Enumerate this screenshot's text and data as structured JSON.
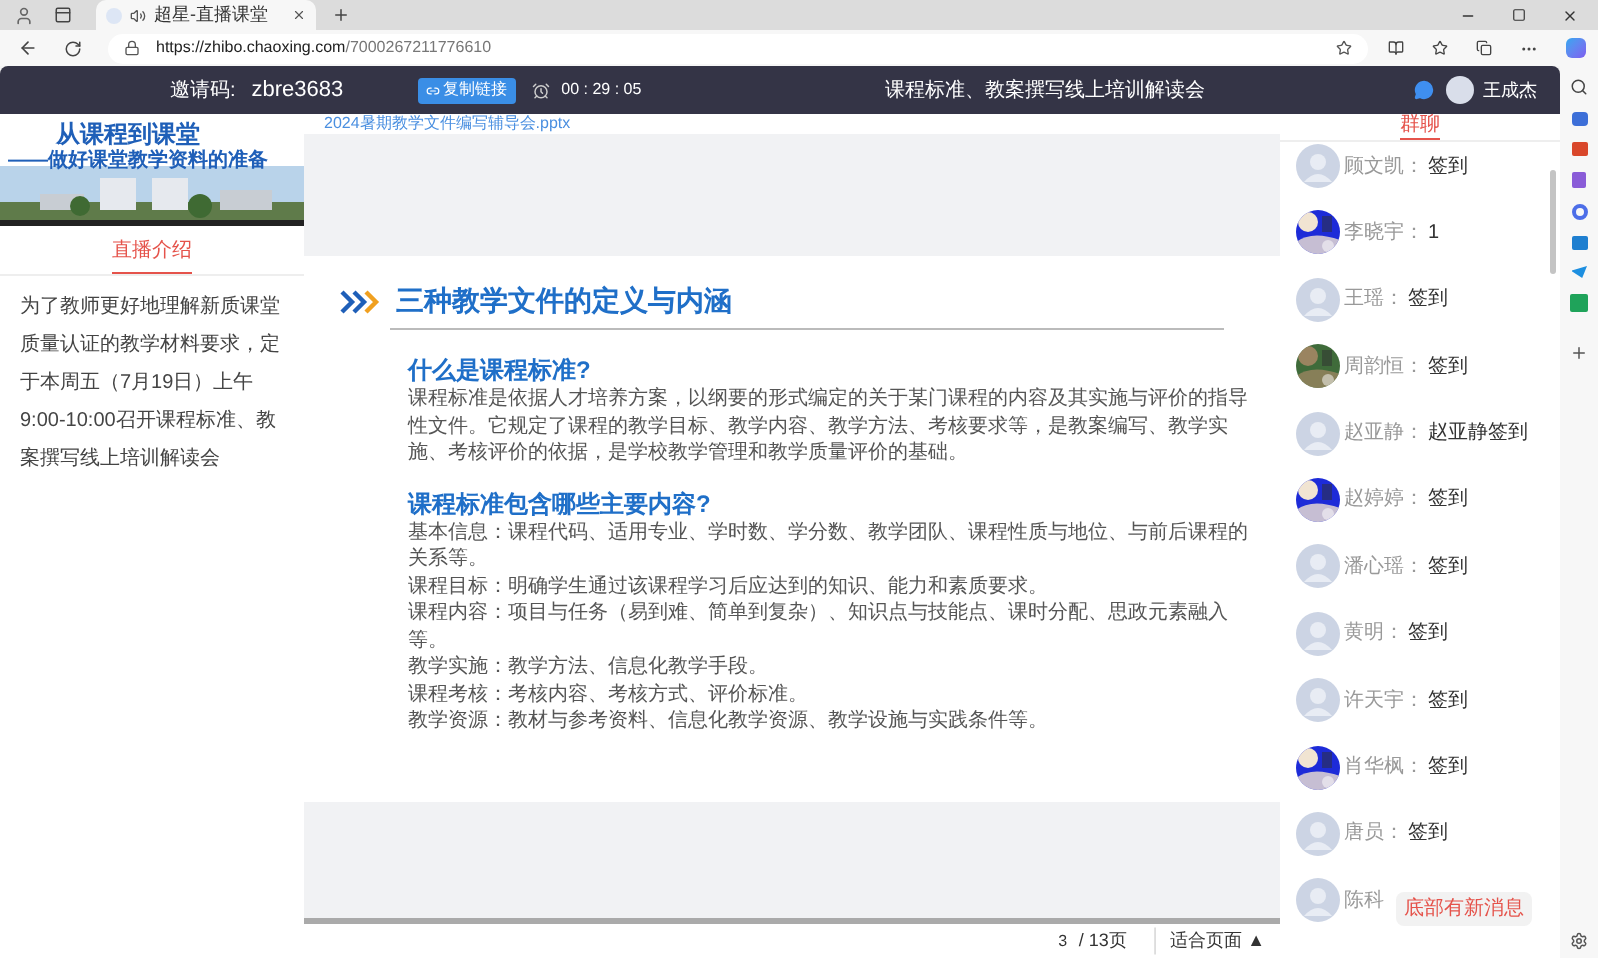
{
  "browser": {
    "tab_title": "超星-直播课堂",
    "url_host": "https://zhibo.chaoxing.com",
    "url_path": "/7000267211776610"
  },
  "header": {
    "invite_label": "邀请码:",
    "invite_code": "zbre3683",
    "copy_button": "复制链接",
    "timer": "00 : 29 : 05",
    "title": "课程标准、教案撰写线上培训解读会",
    "user": "王成杰"
  },
  "left": {
    "cover_title": "从课程到课堂",
    "cover_subtitle": "——做好课堂教学资料的准备",
    "tabs": [
      {
        "label": "直播介绍",
        "selected": true
      }
    ],
    "description": "为了教师更好地理解新质课堂质量认证的教学材料要求，定于本周五（7月19日）上午9:00-10:00召开课程标准、教案撰写线上培训解读会"
  },
  "document": {
    "filename": "2024暑期教学文件编写辅导会.pptx",
    "slide": {
      "heading": "三种教学文件的定义与内涵",
      "sections": [
        {
          "title": "什么是课程标准?",
          "lines": [
            "课程标准是依据人才培养方案，以纲要的形式编定的关于某门课程的内容及其实施与评价的指导性文件。它规定了课程的教学目标、教学内容、教学方法、考核要求等，是教案编写、教学实施、考核评价的依据，是学校教学管理和教学质量评价的基础。"
          ]
        },
        {
          "title": "课程标准包含哪些主要内容?",
          "lines": [
            "基本信息：课程代码、适用专业、学时数、学分数、教学团队、课程性质与地位、与前后课程的关系等。",
            "课程目标：明确学生通过该课程学习后应达到的知识、能力和素质要求。",
            "课程内容：项目与任务（易到难、简单到复杂）、知识点与技能点、课时分配、思政元素融入等。",
            "教学实施：教学方法、信息化教学手段。",
            "课程考核：考核内容、考核方式、评价标准。",
            "教学资源：教材与参考资料、信息化教学资源、教学设施与实践条件等。"
          ]
        }
      ]
    },
    "page": "3",
    "pages": "/ 13页",
    "fit": "适合页面 ▲"
  },
  "chat": {
    "tabs": [
      {
        "label": "群聊",
        "selected": true
      }
    ],
    "messages": [
      {
        "name": "顾文凯：",
        "text": "签到",
        "kind": "default"
      },
      {
        "name": "李晓宇：",
        "text": "1"
      },
      {
        "name": "王瑶：",
        "text": "签到",
        "kind": "default"
      },
      {
        "name": "周韵恒：",
        "text": "签到"
      },
      {
        "name": "赵亚静：",
        "text": "赵亚静签到",
        "kind": "default"
      },
      {
        "name": "赵婷婷：",
        "text": "签到"
      },
      {
        "name": "潘心瑶：",
        "text": "签到",
        "kind": "default"
      },
      {
        "name": "黄明：",
        "text": "签到",
        "kind": "default"
      },
      {
        "name": "许天宇：",
        "text": "签到",
        "kind": "default"
      },
      {
        "name": "肖华枫：",
        "text": "签到"
      },
      {
        "name": "唐员：",
        "text": "签到",
        "kind": "default"
      },
      {
        "name": "陈科",
        "kind": "default"
      }
    ],
    "new_message_toast": "底部有新消息"
  }
}
